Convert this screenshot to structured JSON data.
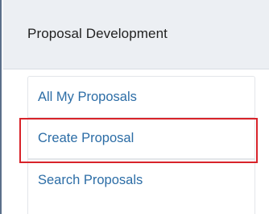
{
  "panel": {
    "title": "Proposal Development",
    "items": [
      {
        "label": "All My Proposals"
      },
      {
        "label": "Create Proposal"
      },
      {
        "label": "Search Proposals"
      }
    ]
  },
  "colors": {
    "link": "#2c6da6",
    "highlight_border": "#d8232a",
    "header_background": "#eceff3"
  }
}
